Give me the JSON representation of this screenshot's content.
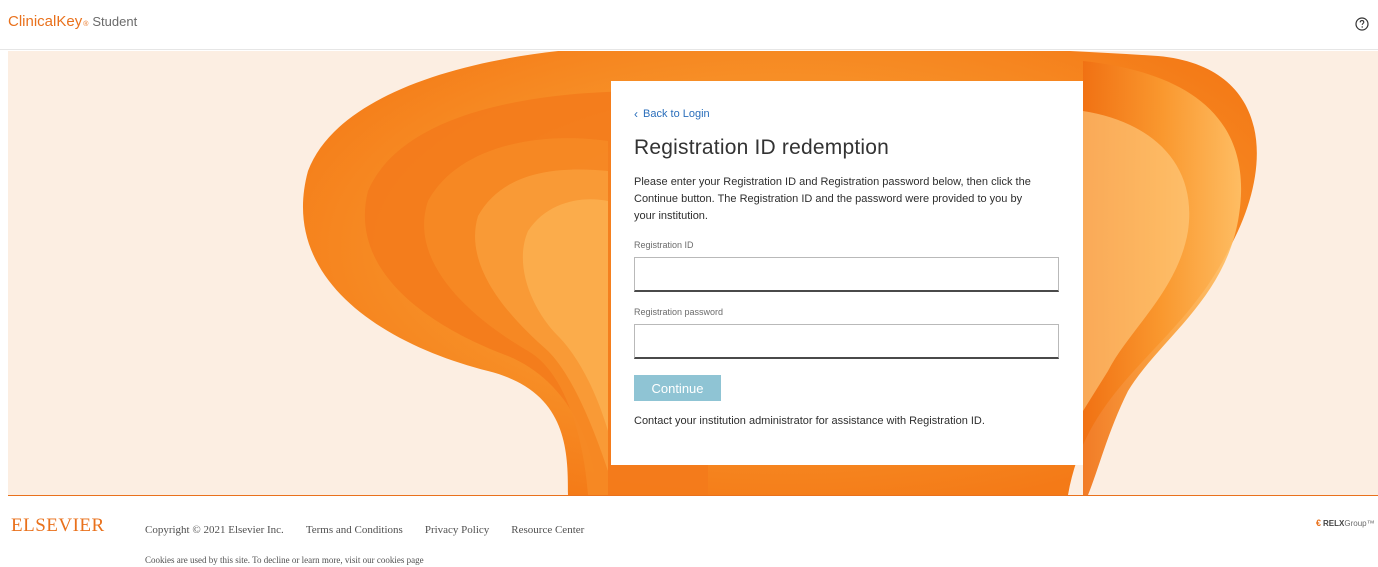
{
  "header": {
    "brand": "ClinicalKey",
    "brand_reg": "®",
    "brand_sub": "Student",
    "help_icon": "help-circle-icon"
  },
  "card": {
    "back_label": "Back to Login",
    "title": "Registration ID redemption",
    "description": "Please enter your Registration ID and Registration password below, then click the Continue button. The Registration ID and the password were provided to you by your institution.",
    "id_label": "Registration ID",
    "id_value": "",
    "password_label": "Registration password",
    "password_value": "",
    "continue_label": "Continue",
    "help_text": "Contact your institution administrator for assistance with Registration ID."
  },
  "footer": {
    "logo": "ELSEVIER",
    "copyright": "Copyright © 2021 Elsevier Inc.",
    "links": [
      "Terms and Conditions",
      "Privacy Policy",
      "Resource Center"
    ],
    "cookies": "Cookies are used by this site. To decline or learn more, visit our cookies page",
    "relx_mark": "€",
    "relx_bold": "RELX",
    "relx_light": "Group™"
  },
  "colors": {
    "brand_orange": "#e9711c",
    "link_blue": "#2a6ebb",
    "button_disabled": "#8fc4d4",
    "hero_bg": "#fceee2"
  }
}
